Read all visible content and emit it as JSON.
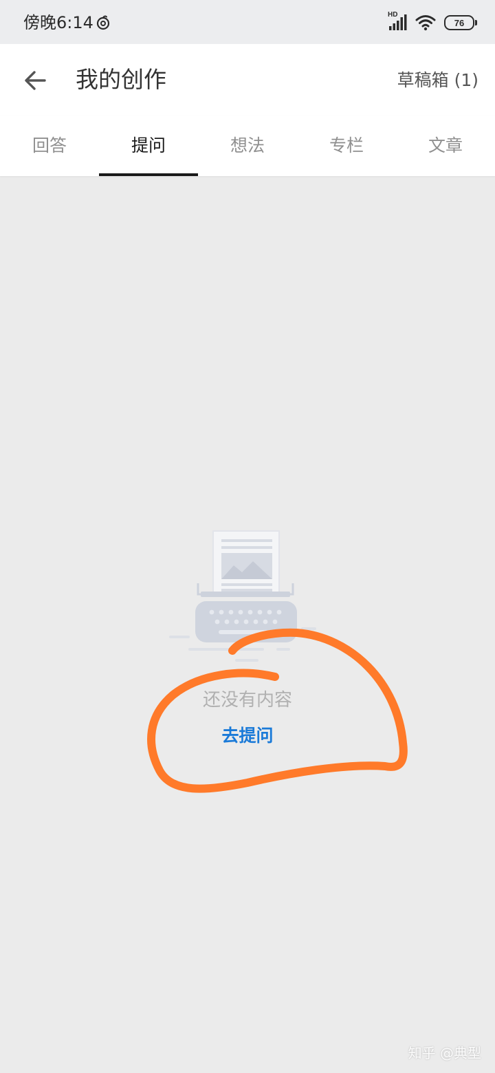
{
  "status_bar": {
    "time": "傍晚6:14",
    "network_label": "HD",
    "battery_level": "76"
  },
  "header": {
    "title": "我的创作",
    "drafts_label": "草稿箱 (1)"
  },
  "tabs": [
    {
      "label": "回答",
      "active": false
    },
    {
      "label": "提问",
      "active": true
    },
    {
      "label": "想法",
      "active": false
    },
    {
      "label": "专栏",
      "active": false
    },
    {
      "label": "文章",
      "active": false
    }
  ],
  "empty_state": {
    "message": "还没有内容",
    "action_label": "去提问",
    "illustration_icon": "typewriter-icon"
  },
  "annotation": {
    "color": "#ff7a2a"
  },
  "watermark": {
    "text": "知乎 @典型"
  },
  "colors": {
    "link": "#1a7ad8",
    "background": "#ebebeb",
    "annotation": "#ff7a2a"
  }
}
